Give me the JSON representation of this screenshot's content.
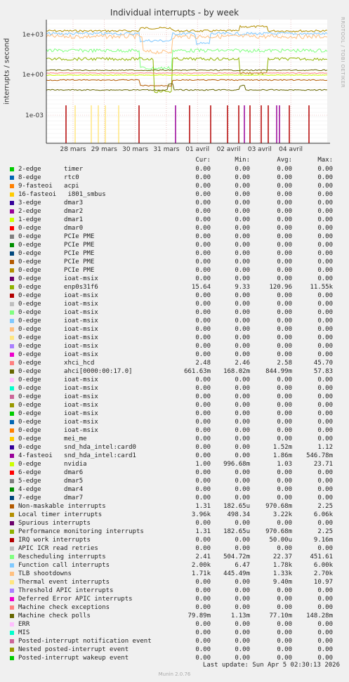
{
  "chart_data": {
    "type": "line",
    "title": "Individual interrupts - by week",
    "ylabel": "interrupts / second",
    "y_scale": "log",
    "y_ticks": [
      "1e-03",
      "1e+00",
      "1e+03"
    ],
    "x_ticks": [
      "28 mars",
      "29 mars",
      "30 mars",
      "31 mars",
      "01 avril",
      "02 avril",
      "03 avril",
      "04 avril"
    ],
    "grid": true,
    "columns": [
      "Cur:",
      "Min:",
      "Avg:",
      "Max:"
    ],
    "series": [
      {
        "name": "2-edge      timer",
        "color": "#00cc00",
        "cur": "0.00",
        "min": "0.00",
        "avg": "0.00",
        "max": "0.00"
      },
      {
        "name": "8-edge      rtc0",
        "color": "#0066b3",
        "cur": "0.00",
        "min": "0.00",
        "avg": "0.00",
        "max": "0.00"
      },
      {
        "name": "9-fasteoi   acpi",
        "color": "#ff8000",
        "cur": "0.00",
        "min": "0.00",
        "avg": "0.00",
        "max": "0.00"
      },
      {
        "name": "16-fasteoi   i801_smbus",
        "color": "#ffcc00",
        "cur": "0.00",
        "min": "0.00",
        "avg": "0.00",
        "max": "0.00"
      },
      {
        "name": "3-edge      dmar3",
        "color": "#330099",
        "cur": "0.00",
        "min": "0.00",
        "avg": "0.00",
        "max": "0.00"
      },
      {
        "name": "2-edge      dmar2",
        "color": "#990099",
        "cur": "0.00",
        "min": "0.00",
        "avg": "0.00",
        "max": "0.00"
      },
      {
        "name": "1-edge      dmar1",
        "color": "#ccff00",
        "cur": "0.00",
        "min": "0.00",
        "avg": "0.00",
        "max": "0.00"
      },
      {
        "name": "0-edge      dmar0",
        "color": "#ff0000",
        "cur": "0.00",
        "min": "0.00",
        "avg": "0.00",
        "max": "0.00"
      },
      {
        "name": "0-edge      PCIe PME",
        "color": "#808080",
        "cur": "0.00",
        "min": "0.00",
        "avg": "0.00",
        "max": "0.00"
      },
      {
        "name": "0-edge      PCIe PME",
        "color": "#008f00",
        "cur": "0.00",
        "min": "0.00",
        "avg": "0.00",
        "max": "0.00"
      },
      {
        "name": "0-edge      PCIe PME",
        "color": "#00487d",
        "cur": "0.00",
        "min": "0.00",
        "avg": "0.00",
        "max": "0.00"
      },
      {
        "name": "0-edge      PCIe PME",
        "color": "#b35a00",
        "cur": "0.00",
        "min": "0.00",
        "avg": "0.00",
        "max": "0.00"
      },
      {
        "name": "0-edge      PCIe PME",
        "color": "#b38f00",
        "cur": "0.00",
        "min": "0.00",
        "avg": "0.00",
        "max": "0.00"
      },
      {
        "name": "0-edge      ioat-msix",
        "color": "#6b006b",
        "cur": "0.00",
        "min": "0.00",
        "avg": "0.00",
        "max": "0.00"
      },
      {
        "name": "0-edge      enp0s31f6",
        "color": "#8fb300",
        "cur": "15.64",
        "min": "9.33",
        "avg": "120.96",
        "max": "11.55k"
      },
      {
        "name": "0-edge      ioat-msix",
        "color": "#b30000",
        "cur": "0.00",
        "min": "0.00",
        "avg": "0.00",
        "max": "0.00"
      },
      {
        "name": "0-edge      ioat-msix",
        "color": "#bebebe",
        "cur": "0.00",
        "min": "0.00",
        "avg": "0.00",
        "max": "0.00"
      },
      {
        "name": "0-edge      ioat-msix",
        "color": "#80ff80",
        "cur": "0.00",
        "min": "0.00",
        "avg": "0.00",
        "max": "0.00"
      },
      {
        "name": "0-edge      ioat-msix",
        "color": "#80c9ff",
        "cur": "0.00",
        "min": "0.00",
        "avg": "0.00",
        "max": "0.00"
      },
      {
        "name": "0-edge      ioat-msix",
        "color": "#ffc080",
        "cur": "0.00",
        "min": "0.00",
        "avg": "0.00",
        "max": "0.00"
      },
      {
        "name": "0-edge      ioat-msix",
        "color": "#ffe680",
        "cur": "0.00",
        "min": "0.00",
        "avg": "0.00",
        "max": "0.00"
      },
      {
        "name": "0-edge      ioat-msix",
        "color": "#aa80ff",
        "cur": "0.00",
        "min": "0.00",
        "avg": "0.00",
        "max": "0.00"
      },
      {
        "name": "0-edge      ioat-msix",
        "color": "#ee00cc",
        "cur": "0.00",
        "min": "0.00",
        "avg": "0.00",
        "max": "0.00"
      },
      {
        "name": "0-edge      xhci_hcd",
        "color": "#ff8080",
        "cur": "2.48",
        "min": "2.46",
        "avg": "2.58",
        "max": "45.70"
      },
      {
        "name": "0-edge      ahci[0000:00:17.0]",
        "color": "#666600",
        "cur": "661.63m",
        "min": "168.02m",
        "avg": "844.99m",
        "max": "57.83"
      },
      {
        "name": "0-edge      ioat-msix",
        "color": "#ffbfff",
        "cur": "0.00",
        "min": "0.00",
        "avg": "0.00",
        "max": "0.00"
      },
      {
        "name": "0-edge      ioat-msix",
        "color": "#00ffcc",
        "cur": "0.00",
        "min": "0.00",
        "avg": "0.00",
        "max": "0.00"
      },
      {
        "name": "0-edge      ioat-msix",
        "color": "#cc6699",
        "cur": "0.00",
        "min": "0.00",
        "avg": "0.00",
        "max": "0.00"
      },
      {
        "name": "0-edge      ioat-msix",
        "color": "#999900",
        "cur": "0.00",
        "min": "0.00",
        "avg": "0.00",
        "max": "0.00"
      },
      {
        "name": "0-edge      ioat-msix",
        "color": "#00cc00",
        "cur": "0.00",
        "min": "0.00",
        "avg": "0.00",
        "max": "0.00"
      },
      {
        "name": "0-edge      ioat-msix",
        "color": "#0066b3",
        "cur": "0.00",
        "min": "0.00",
        "avg": "0.00",
        "max": "0.00"
      },
      {
        "name": "0-edge      ioat-msix",
        "color": "#ff8000",
        "cur": "0.00",
        "min": "0.00",
        "avg": "0.00",
        "max": "0.00"
      },
      {
        "name": "0-edge      mei_me",
        "color": "#ffcc00",
        "cur": "0.00",
        "min": "0.00",
        "avg": "0.00",
        "max": "0.00"
      },
      {
        "name": "0-edge      snd_hda_intel:card0",
        "color": "#330099",
        "cur": "0.00",
        "min": "0.00",
        "avg": "1.52m",
        "max": "1.12"
      },
      {
        "name": "4-fasteoi   snd_hda_intel:card1",
        "color": "#990099",
        "cur": "0.00",
        "min": "0.00",
        "avg": "1.86m",
        "max": "546.78m"
      },
      {
        "name": "0-edge      nvidia",
        "color": "#ccff00",
        "cur": "1.00",
        "min": "996.68m",
        "avg": "1.03",
        "max": "23.71"
      },
      {
        "name": "6-edge      dmar6",
        "color": "#ff0000",
        "cur": "0.00",
        "min": "0.00",
        "avg": "0.00",
        "max": "0.00"
      },
      {
        "name": "5-edge      dmar5",
        "color": "#808080",
        "cur": "0.00",
        "min": "0.00",
        "avg": "0.00",
        "max": "0.00"
      },
      {
        "name": "4-edge      dmar4",
        "color": "#008f00",
        "cur": "0.00",
        "min": "0.00",
        "avg": "0.00",
        "max": "0.00"
      },
      {
        "name": "7-edge      dmar7",
        "color": "#00487d",
        "cur": "0.00",
        "min": "0.00",
        "avg": "0.00",
        "max": "0.00"
      },
      {
        "name": "Non-maskable interrupts",
        "color": "#b35a00",
        "cur": "1.31",
        "min": "182.65u",
        "avg": "970.68m",
        "max": "2.25"
      },
      {
        "name": "Local timer interrupts",
        "color": "#b38f00",
        "cur": "3.96k",
        "min": "498.34",
        "avg": "3.22k",
        "max": "6.06k"
      },
      {
        "name": "Spurious interrupts",
        "color": "#6b006b",
        "cur": "0.00",
        "min": "0.00",
        "avg": "0.00",
        "max": "0.00"
      },
      {
        "name": "Performance monitoring interrupts",
        "color": "#8fb300",
        "cur": "1.31",
        "min": "182.65u",
        "avg": "970.68m",
        "max": "2.25"
      },
      {
        "name": "IRQ work interrupts",
        "color": "#b30000",
        "cur": "0.00",
        "min": "0.00",
        "avg": "50.00u",
        "max": "9.16m"
      },
      {
        "name": "APIC ICR read retries",
        "color": "#bebebe",
        "cur": "0.00",
        "min": "0.00",
        "avg": "0.00",
        "max": "0.00"
      },
      {
        "name": "Rescheduling interrupts",
        "color": "#80ff80",
        "cur": "2.41",
        "min": "504.72m",
        "avg": "22.37",
        "max": "451.61"
      },
      {
        "name": "Function call interrupts",
        "color": "#80c9ff",
        "cur": "2.00k",
        "min": "6.47",
        "avg": "1.78k",
        "max": "6.00k"
      },
      {
        "name": "TLB shootdowns",
        "color": "#ffc080",
        "cur": "1.71k",
        "min": "445.49m",
        "avg": "1.33k",
        "max": "2.70k"
      },
      {
        "name": "Thermal event interrupts",
        "color": "#ffe680",
        "cur": "0.00",
        "min": "0.00",
        "avg": "9.40m",
        "max": "10.97"
      },
      {
        "name": "Threshold APIC interrupts",
        "color": "#aa80ff",
        "cur": "0.00",
        "min": "0.00",
        "avg": "0.00",
        "max": "0.00"
      },
      {
        "name": "Deferred Error APIC interrupts",
        "color": "#ee00cc",
        "cur": "0.00",
        "min": "0.00",
        "avg": "0.00",
        "max": "0.00"
      },
      {
        "name": "Machine check exceptions",
        "color": "#ff8080",
        "cur": "0.00",
        "min": "0.00",
        "avg": "0.00",
        "max": "0.00"
      },
      {
        "name": "Machine check polls",
        "color": "#666600",
        "cur": "79.89m",
        "min": "1.13m",
        "avg": "77.10m",
        "max": "148.28m"
      },
      {
        "name": "ERR",
        "color": "#ffbfff",
        "cur": "0.00",
        "min": "0.00",
        "avg": "0.00",
        "max": "0.00"
      },
      {
        "name": "MIS",
        "color": "#00ffcc",
        "cur": "0.00",
        "min": "0.00",
        "avg": "0.00",
        "max": "0.00"
      },
      {
        "name": "Posted-interrupt notification event",
        "color": "#cc6699",
        "cur": "0.00",
        "min": "0.00",
        "avg": "0.00",
        "max": "0.00"
      },
      {
        "name": "Nested posted-interrupt event",
        "color": "#999900",
        "cur": "0.00",
        "min": "0.00",
        "avg": "0.00",
        "max": "0.00"
      },
      {
        "name": "Posted-interrupt wakeup event",
        "color": "#00cc00",
        "cur": "0.00",
        "min": "0.00",
        "avg": "0.00",
        "max": "0.00"
      }
    ]
  },
  "sidebar_text": "RRDTOOL / TOBI OETIKER",
  "last_update": "Last update: Sun Apr  5 02:30:13 2026",
  "footer": "Munin 2.0.76"
}
